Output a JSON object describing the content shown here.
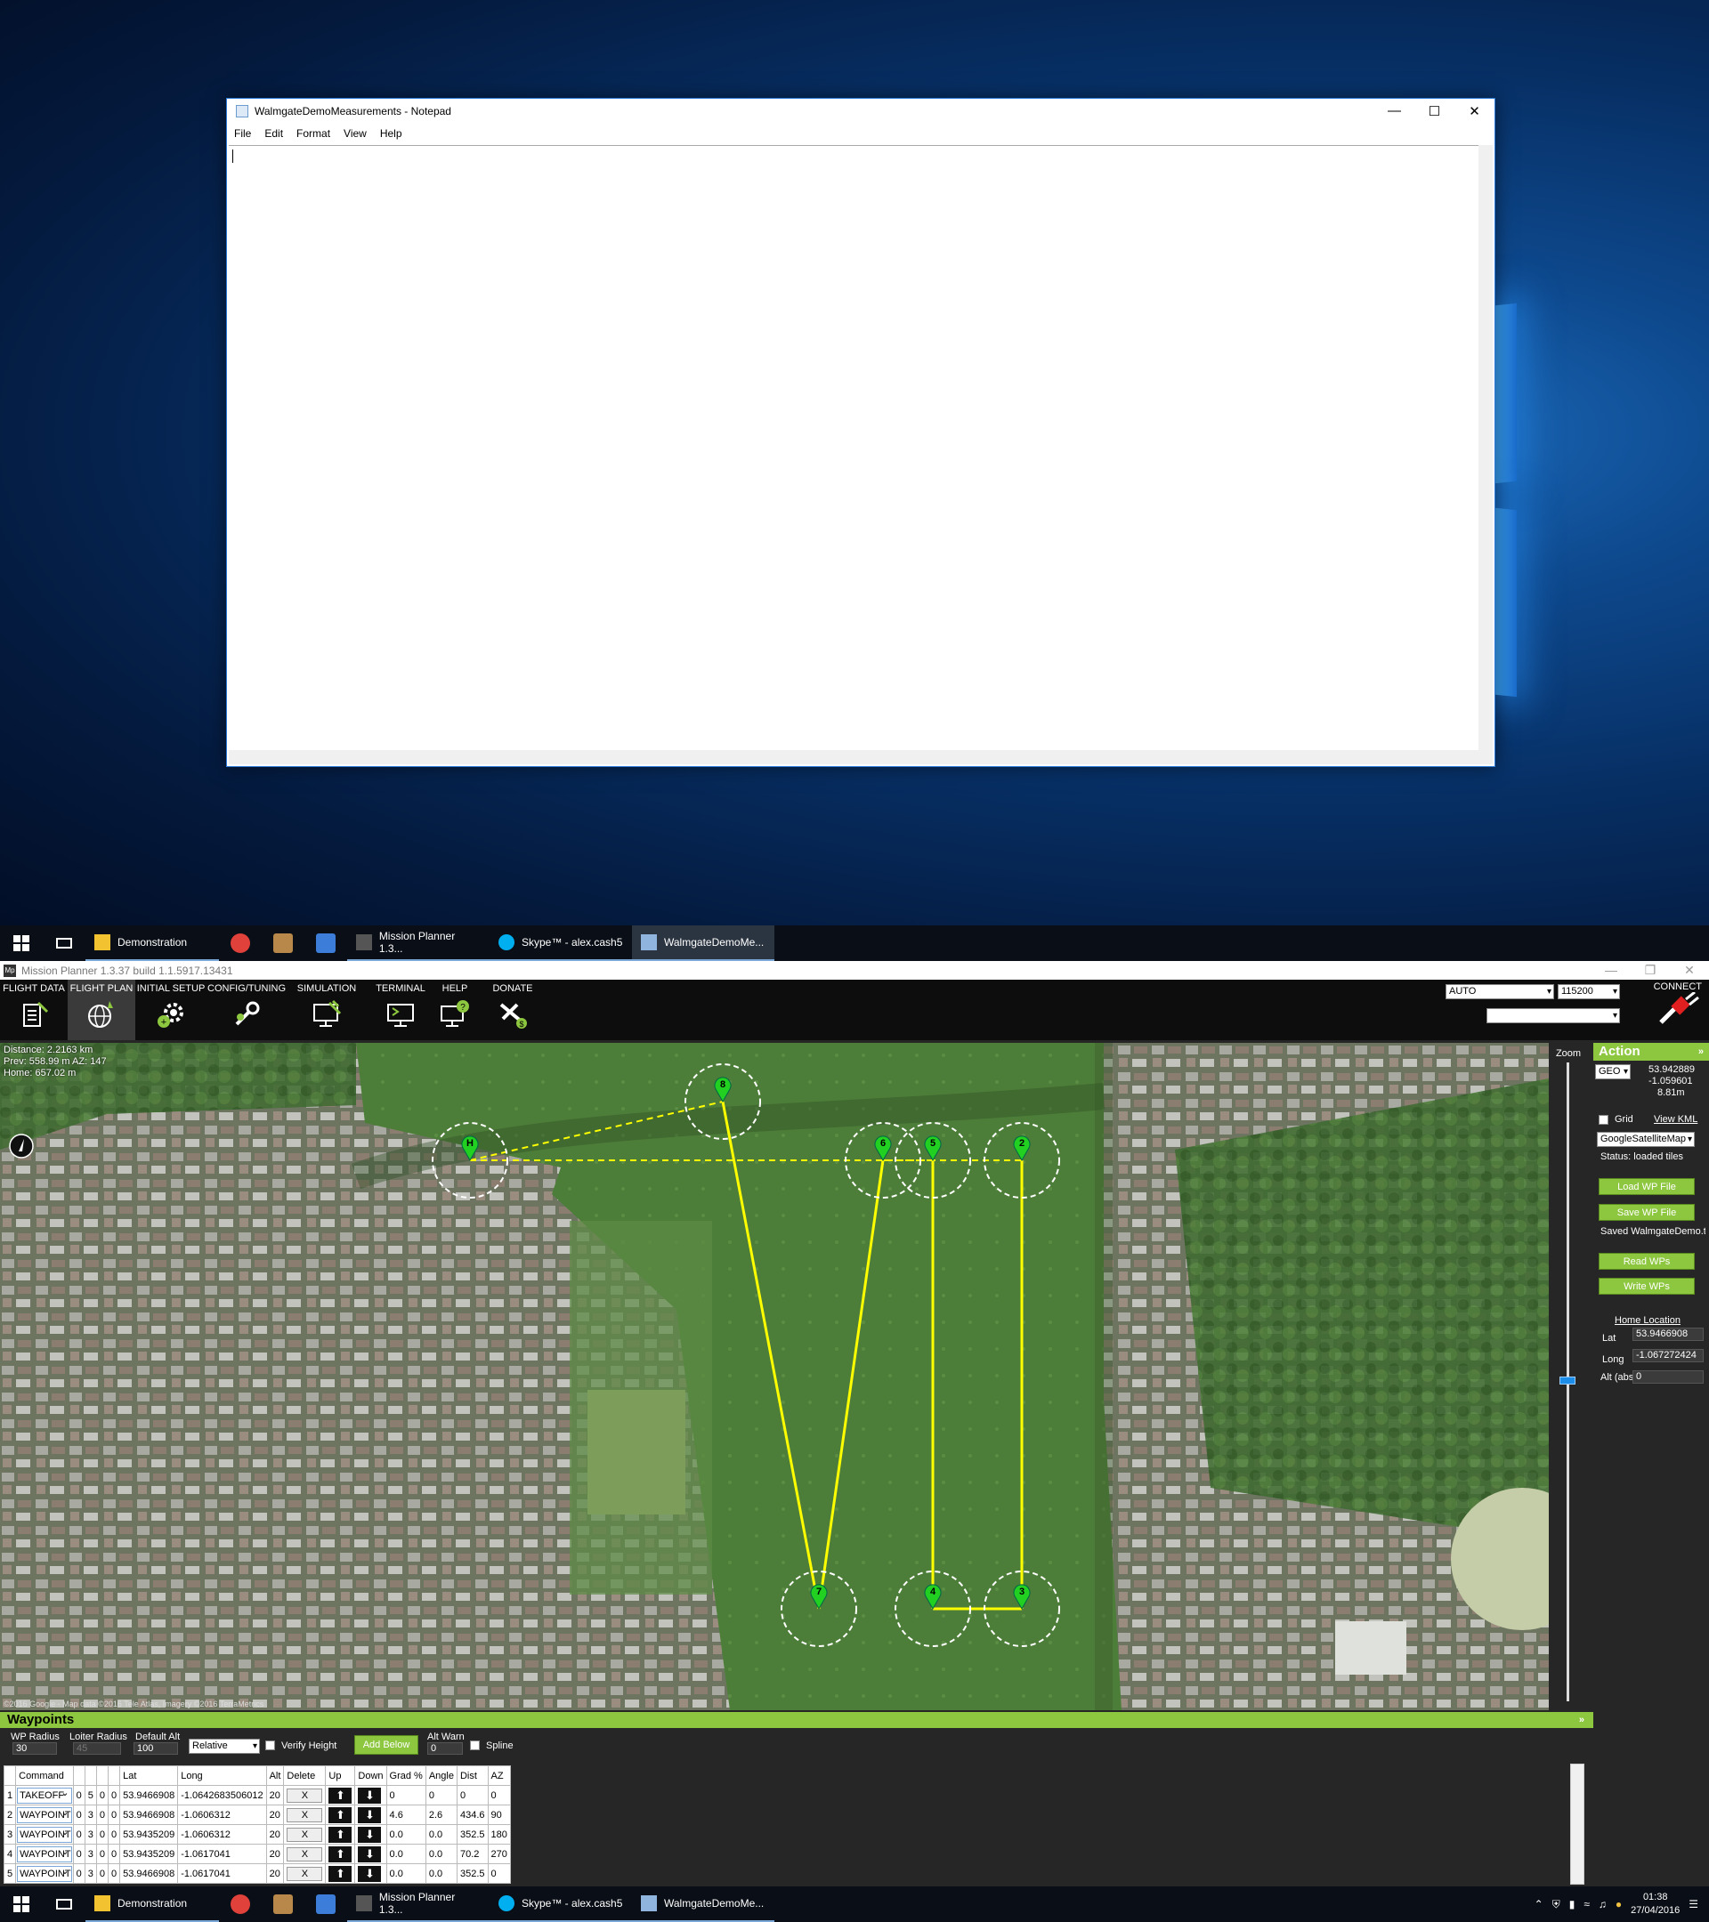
{
  "notepad": {
    "title": "WalmgateDemoMeasurements - Notepad",
    "menu": [
      "File",
      "Edit",
      "Format",
      "View",
      "Help"
    ],
    "content": ""
  },
  "taskbar": {
    "items": [
      {
        "label": "Demonstration",
        "icon": "folder-icon",
        "color": "#f2c231"
      },
      {
        "label": "",
        "icon": "chrome-icon",
        "color": "#e0413a"
      },
      {
        "label": "",
        "icon": "app-icon",
        "color": "#b7884a"
      },
      {
        "label": "",
        "icon": "network-app-icon",
        "color": "#3b7dd8"
      },
      {
        "label": "Mission Planner 1.3...",
        "icon": "mission-planner-icon",
        "color": "#555555"
      },
      {
        "label": "Skype™ - alex.cash5",
        "icon": "skype-icon",
        "color": "#00aff0"
      },
      {
        "label": "WalmgateDemoMe...",
        "icon": "notepad-icon",
        "color": "#8fb4de"
      }
    ],
    "clock_time": "01:38",
    "clock_date": "27/04/2016"
  },
  "mission_planner": {
    "window_title": "Mission Planner 1.3.37 build 1.1.5917.13431",
    "tabs": [
      "FLIGHT DATA",
      "FLIGHT PLAN",
      "INITIAL SETUP",
      "CONFIG/TUNING",
      "SIMULATION",
      "TERMINAL",
      "HELP",
      "DONATE"
    ],
    "selected_tab": "FLIGHT PLAN",
    "mode_value": "AUTO",
    "baud_value": "115200",
    "connect_label": "CONNECT",
    "map_info": {
      "distance": "Distance: 2.2163 km",
      "prev": "Prev: 558.99 m AZ: 147",
      "home": "Home: 657.02 m"
    },
    "map_attribution": "©2016 Google - Map data ©2016 Tele Atlas, Imagery ©2016 TerraMetrics",
    "zoom_label": "Zoom",
    "zoom_level": 0.44,
    "waypoints_on_map": [
      {
        "label": "H"
      },
      {
        "label": "2"
      },
      {
        "label": "3"
      },
      {
        "label": "4"
      },
      {
        "label": "5"
      },
      {
        "label": "6"
      },
      {
        "label": "7"
      },
      {
        "label": "8"
      }
    ],
    "action": {
      "title": "Action",
      "coord_mode": "GEO",
      "cursor_lat": "53.942889",
      "cursor_long": "-1.059601",
      "cursor_alt": "8.81m",
      "grid_label": "Grid",
      "view_kml_label": "View KML",
      "map_type": "GoogleSatelliteMap",
      "status": "Status: loaded tiles",
      "load_wp_label": "Load WP File",
      "save_wp_label": "Save WP File",
      "saved_text": "Saved WalmgateDemo.t",
      "read_wps_label": "Read WPs",
      "write_wps_label": "Write WPs",
      "home_location_label": "Home Location",
      "lat_label": "Lat",
      "lat_value": "53.9466908",
      "long_label": "Long",
      "long_value": "-1.067272424",
      "alt_label": "Alt (abs)",
      "alt_value": "0"
    },
    "waypoints_panel": {
      "title": "Waypoints",
      "wp_radius_label": "WP Radius",
      "wp_radius_value": "30",
      "loiter_radius_label": "Loiter Radius",
      "loiter_radius_value": "45",
      "default_alt_label": "Default Alt",
      "default_alt_value": "100",
      "frame_value": "Relative",
      "verify_height_label": "Verify Height",
      "add_below_label": "Add Below",
      "alt_warn_label": "Alt Warn",
      "alt_warn_value": "0",
      "spline_label": "Spline",
      "columns": [
        "",
        "Command",
        "",
        "",
        "",
        "",
        "Lat",
        "Long",
        "Alt",
        "Delete",
        "Up",
        "Down",
        "Grad %",
        "Angle",
        "Dist",
        "AZ"
      ],
      "rows": [
        {
          "num": "1",
          "command": "TAKEOFF",
          "p1": "0",
          "p2": "5",
          "p3": "0",
          "p4": "0",
          "lat": "53.9466908",
          "long": "-1.0642683506012",
          "alt": "20",
          "delete": "X",
          "grad": "0",
          "angle": "0",
          "dist": "0",
          "az": "0"
        },
        {
          "num": "2",
          "command": "WAYPOINT",
          "p1": "0",
          "p2": "3",
          "p3": "0",
          "p4": "0",
          "lat": "53.9466908",
          "long": "-1.0606312",
          "alt": "20",
          "delete": "X",
          "grad": "4.6",
          "angle": "2.6",
          "dist": "434.6",
          "az": "90"
        },
        {
          "num": "3",
          "command": "WAYPOINT",
          "p1": "0",
          "p2": "3",
          "p3": "0",
          "p4": "0",
          "lat": "53.9435209",
          "long": "-1.0606312",
          "alt": "20",
          "delete": "X",
          "grad": "0.0",
          "angle": "0.0",
          "dist": "352.5",
          "az": "180"
        },
        {
          "num": "4",
          "command": "WAYPOINT",
          "p1": "0",
          "p2": "3",
          "p3": "0",
          "p4": "0",
          "lat": "53.9435209",
          "long": "-1.0617041",
          "alt": "20",
          "delete": "X",
          "grad": "0.0",
          "angle": "0.0",
          "dist": "70.2",
          "az": "270"
        },
        {
          "num": "5",
          "command": "WAYPOINT",
          "p1": "0",
          "p2": "3",
          "p3": "0",
          "p4": "0",
          "lat": "53.9466908",
          "long": "-1.0617041",
          "alt": "20",
          "delete": "X",
          "grad": "0.0",
          "angle": "0.0",
          "dist": "352.5",
          "az": "0"
        }
      ]
    }
  },
  "colors": {
    "accent_green": "#8dc63f",
    "route_yellow": "#ffff00",
    "waypoint_marker": "#22d022"
  }
}
